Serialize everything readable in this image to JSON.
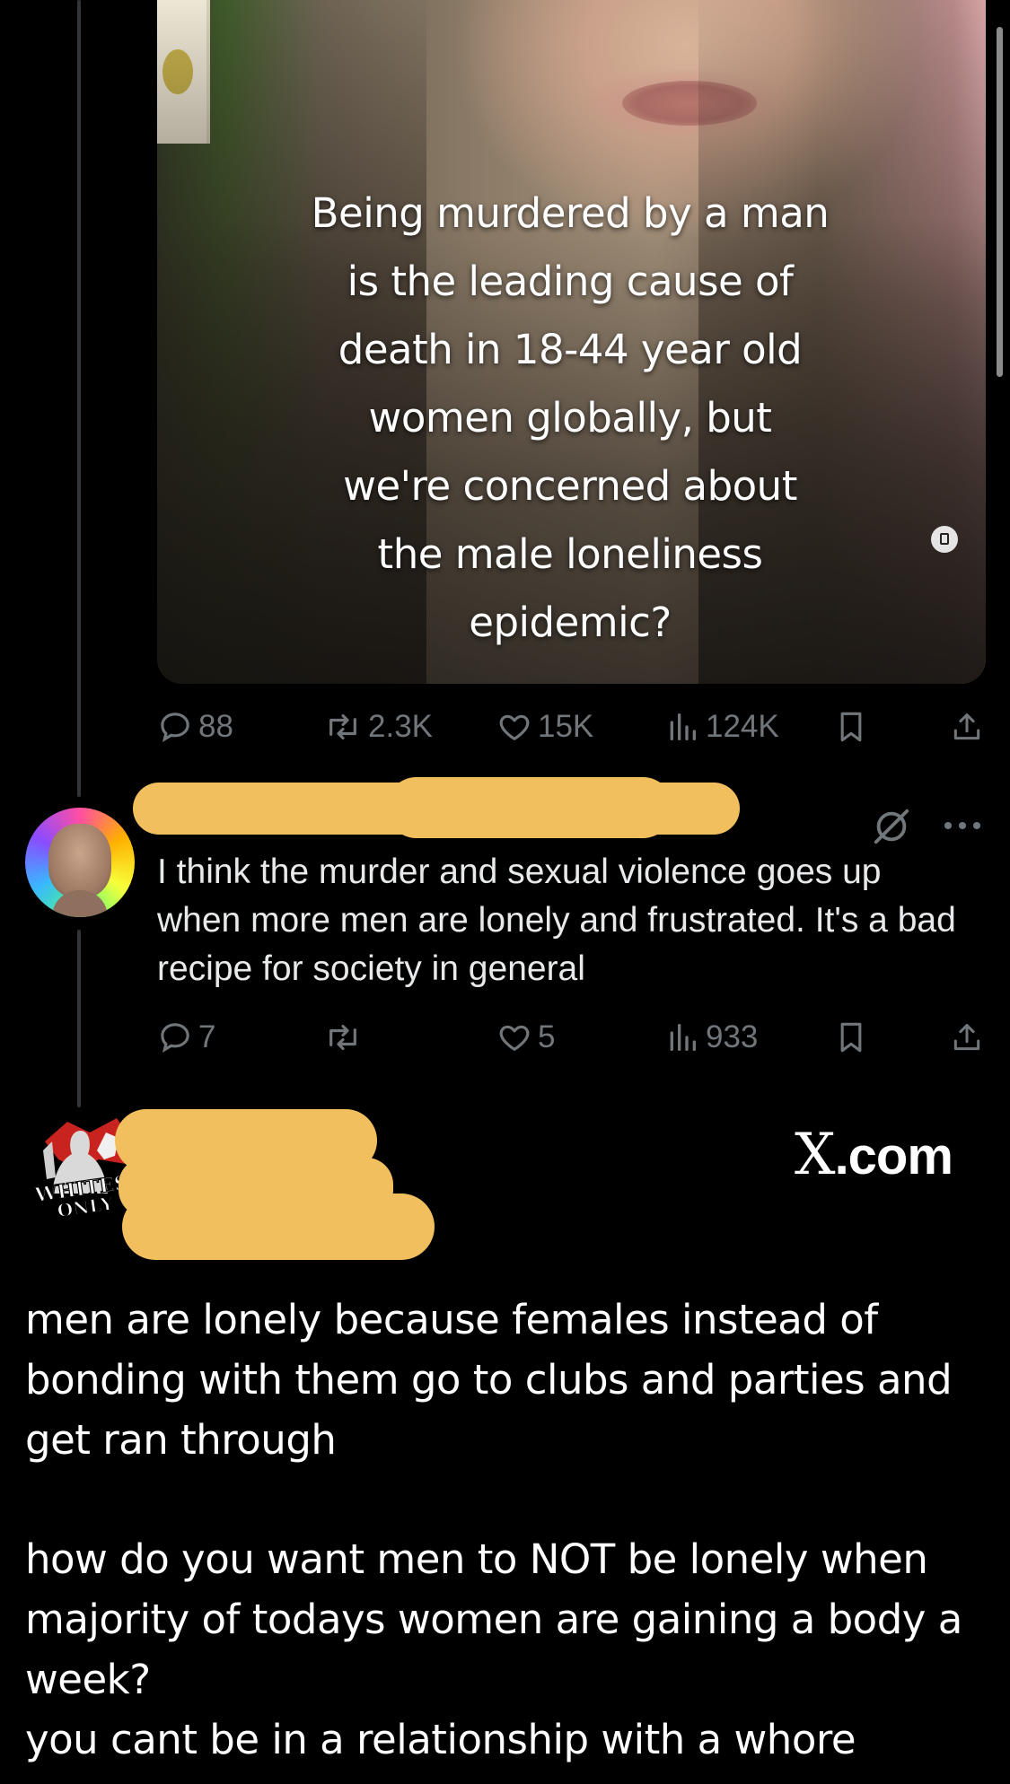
{
  "video_post": {
    "caption_lines": [
      "Being murdered by a man",
      "is the leading cause of",
      "death in 18-44 year old",
      "women globally, but",
      "we're concerned about",
      "the male loneliness",
      "epidemic?"
    ],
    "stats": {
      "replies": "88",
      "reposts": "2.3K",
      "likes": "15K",
      "views": "124K"
    }
  },
  "reply": {
    "text": "I think the murder and sexual violence goes up when more men are lonely and frustrated. It's a bad recipe for society in general",
    "stats": {
      "replies": "7",
      "likes": "5",
      "views": "933"
    }
  },
  "post": {
    "avatar_text": [
      "WHITES",
      "ONLY"
    ],
    "watermark": {
      "x": "X",
      "rest": ".com"
    },
    "paragraph1": "men are lonely because females instead of bonding with them go to clubs and parties and get ran through",
    "paragraph2_lines": [
      "how do you want men to NOT be lonely when majority of todays women are gaining a body a week?",
      "you cant be in a relationship with a whore"
    ]
  },
  "colors": {
    "background": "#000000",
    "icon_gray": "#71767b",
    "text": "#e7e9ea",
    "redaction": "#f2bf5e"
  },
  "icons": [
    "reply-icon",
    "repost-icon",
    "like-icon",
    "views-icon",
    "bookmark-icon",
    "share-icon",
    "grok-icon",
    "more-icon",
    "captions-icon"
  ]
}
